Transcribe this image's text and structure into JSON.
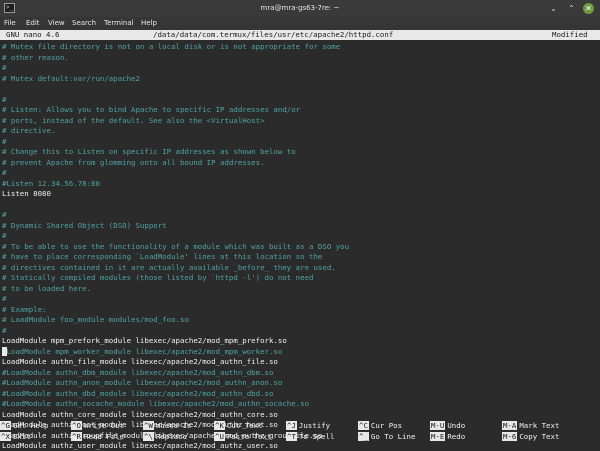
{
  "window": {
    "title": "mra@mra-gs63-7re: ~",
    "term_icon": ">_",
    "minimize": "⌄",
    "maximize": "⌃",
    "close": "✕"
  },
  "menu": [
    "File",
    "Edit",
    "View",
    "Search",
    "Terminal",
    "Help"
  ],
  "nano": {
    "version": "GNU nano 4.6",
    "file": "/data/data/com.termux/files/usr/etc/apache2/httpd.conf",
    "status": "Modified"
  },
  "lines": [
    {
      "text": "# Mutex file directory is not on a local disk or is not appropriate for some",
      "type": "comment"
    },
    {
      "text": "# other reason.",
      "type": "comment"
    },
    {
      "text": "#",
      "type": "comment"
    },
    {
      "text": "# Mutex default:var/run/apache2",
      "type": "comment"
    },
    {
      "text": "",
      "type": "plain"
    },
    {
      "text": "#",
      "type": "comment"
    },
    {
      "text": "# Listen: Allows you to bind Apache to specific IP addresses and/or",
      "type": "comment"
    },
    {
      "text": "# ports, instead of the default. See also the <VirtualHost>",
      "type": "comment"
    },
    {
      "text": "# directive.",
      "type": "comment"
    },
    {
      "text": "#",
      "type": "comment"
    },
    {
      "text": "# Change this to Listen on specific IP addresses as shown below to",
      "type": "comment"
    },
    {
      "text": "# prevent Apache from glomming onto all bound IP addresses.",
      "type": "comment"
    },
    {
      "text": "#",
      "type": "comment"
    },
    {
      "text": "#Listen 12.34.56.78:80",
      "type": "comment"
    },
    {
      "text": "Listen 8080",
      "type": "plain"
    },
    {
      "text": "",
      "type": "plain"
    },
    {
      "text": "#",
      "type": "comment"
    },
    {
      "text": "# Dynamic Shared Object (DSO) Support",
      "type": "comment"
    },
    {
      "text": "#",
      "type": "comment"
    },
    {
      "text": "# To be able to use the functionality of a module which was built as a DSO you",
      "type": "comment"
    },
    {
      "text": "# have to place corresponding `LoadModule' lines at this location so the",
      "type": "comment"
    },
    {
      "text": "# directives contained in it are actually available _before_ they are used.",
      "type": "comment"
    },
    {
      "text": "# Statically compiled modules (those listed by `httpd -l') do not need",
      "type": "comment"
    },
    {
      "text": "# to be loaded here.",
      "type": "comment"
    },
    {
      "text": "#",
      "type": "comment"
    },
    {
      "text": "# Example:",
      "type": "comment"
    },
    {
      "text": "# LoadModule foo_module modules/mod_foo.so",
      "type": "comment"
    },
    {
      "text": "#",
      "type": "comment"
    },
    {
      "text": "LoadModule mpm_prefork_module libexec/apache2/mod_mpm_prefork.so",
      "type": "plain"
    },
    {
      "text": "#LoadModule mpm_worker_module libexec/apache2/mod_mpm_worker.so",
      "type": "comment"
    },
    {
      "text": "LoadModule authn_file_module libexec/apache2/mod_authn_file.so",
      "type": "plain"
    },
    {
      "text": "#LoadModule authn_dbm_module libexec/apache2/mod_authn_dbm.so",
      "type": "comment"
    },
    {
      "text": "#LoadModule authn_anon_module libexec/apache2/mod_authn_anon.so",
      "type": "comment"
    },
    {
      "text": "#LoadModule authn_dbd_module libexec/apache2/mod_authn_dbd.so",
      "type": "comment"
    },
    {
      "text": "#LoadModule authn_socache_module libexec/apache2/mod_authn_socache.so",
      "type": "comment"
    },
    {
      "text": "LoadModule authn_core_module libexec/apache2/mod_authn_core.so",
      "type": "plain"
    },
    {
      "text": "LoadModule authz_host_module libexec/apache2/mod_authz_host.so",
      "type": "plain"
    },
    {
      "text": "LoadModule authz_groupfile_module libexec/apache2/mod_authz_groupfile.so",
      "type": "plain"
    },
    {
      "text": "LoadModule authz_user_module libexec/apache2/mod_authz_user.so",
      "type": "plain"
    }
  ],
  "shortcuts": [
    [
      {
        "key": "^G",
        "label": "Get Help"
      },
      {
        "key": "^X",
        "label": "Exit"
      }
    ],
    [
      {
        "key": "^O",
        "label": "Write Out"
      },
      {
        "key": "^R",
        "label": "Read File"
      }
    ],
    [
      {
        "key": "^W",
        "label": "Where Is"
      },
      {
        "key": "^\\",
        "label": "Replace"
      }
    ],
    [
      {
        "key": "^K",
        "label": "Cut Text"
      },
      {
        "key": "^U",
        "label": "Paste Text"
      }
    ],
    [
      {
        "key": "^J",
        "label": "Justify"
      },
      {
        "key": "^T",
        "label": "To Spell"
      }
    ],
    [
      {
        "key": "^C",
        "label": "Cur Pos"
      },
      {
        "key": "^_",
        "label": "Go To Line"
      }
    ],
    [
      {
        "key": "M-U",
        "label": "Undo"
      },
      {
        "key": "M-E",
        "label": "Redo"
      }
    ],
    [
      {
        "key": "M-A",
        "label": "Mark Text"
      },
      {
        "key": "M-6",
        "label": "Copy Text"
      }
    ]
  ]
}
